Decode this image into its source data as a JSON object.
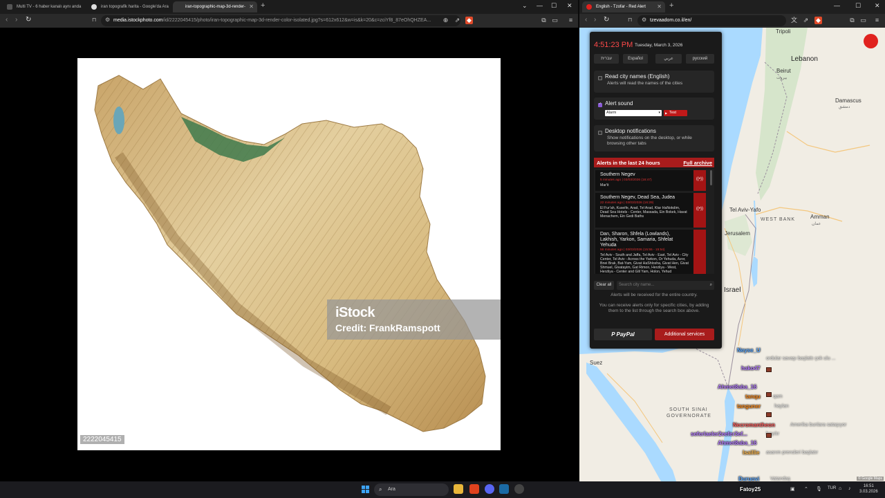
{
  "left_browser": {
    "tabs": [
      {
        "label": "Multi TV - 6 haber kanalı aynı anda"
      },
      {
        "label": "iran topografik harita - Google'da Ara"
      },
      {
        "label": "iran-topographic-map-3d-render-"
      }
    ],
    "url_host": "media.istockphoto.com",
    "url_path": "/id/2222045415/photo/iran-topographic-map-3d-render-color-isolated.jpg?s=612x612&w=is&k=20&c=zciYf8_87eOhQHZEA...",
    "image": {
      "watermark_logo": "iStock",
      "watermark_credit": "Credit: FrankRamspott",
      "image_id": "2222045415"
    }
  },
  "right_browser": {
    "tab_label": "English - Tzofar - Red Alert",
    "url": "tzevaadom.co.il/en/",
    "panel": {
      "time": "4:51:23 PM",
      "date": "Tuesday, March 3, 2026",
      "languages": [
        "עברית",
        "Español",
        "عربي",
        "русский"
      ],
      "read_names": {
        "title": "Read city names (English)",
        "desc": "Alerts will read the names of the cities"
      },
      "alert_sound": {
        "title": "Alert sound",
        "selected": "Alarm",
        "test_label": "Test"
      },
      "desktop": {
        "title": "Desktop notifications",
        "desc": "Show notifications on the desktop, or while browsing other tabs"
      },
      "alerts_title": "Alerts in the last 24 hours",
      "archive_label": "Full archive",
      "alerts": [
        {
          "area": "Southern Negev",
          "time": "5 minutes ago | 03/03/2026 (16:47)",
          "cities": "Mar'it"
        },
        {
          "area": "Southern Negev, Dead Sea, Judea",
          "time": "22 minutes ago | 03/03/2026 (16:29)",
          "cities": "El Fur'ah, Kuseife, Arad, Tel Arad, Ktar HaNokdim, Dead Sea Hotels - Center, Massada, Ein Bokek, Havat Menachem, Ein Gedi Baths"
        },
        {
          "area": "Dan, Sharon, Shfela (Lowlands), Lakhish, Yarkon, Samaria, Shfelat Yehuda",
          "time": "56 minutes ago | 03/03/2026 (15:55 - 15:54)",
          "cities": "Tel Aviv - South and Jaffa, Tel Aviv - East, Tel Aviv - City Center, Tel Aviv - Across the Yarkon, Or Yehuda, Azor, Bnei Brak, Bat-Yam, Givat HaShlosha, Givat Hen, Givat Shmuel, Givatayim, Gat Rimon, Herzliya - West, Herzliya - Center and Glil Yam, Holon, Yehud"
        }
      ],
      "clear_label": "Clear all",
      "search_placeholder": "Search city name...",
      "info1": "Alerts will be received for the entire country.",
      "info2": "You can receive alerts only for specific cities, by adding them to the list through the search box above.",
      "paypal_label": "PayPal",
      "services_label": "Additional services"
    },
    "map": {
      "labels": {
        "tripoli": "Tripoli",
        "lebanon": "Lebanon",
        "beirut": "Beirut",
        "beirut_ar": "بيروت",
        "damascus": "Damascus",
        "damascus_ar": "دمشق",
        "tel_aviv": "Tel Aviv-Yafo",
        "west_bank": "WEST BANK",
        "amman": "Amman",
        "amman_ar": "عمان",
        "jerusalem": "Jerusalem",
        "israel": "Israel",
        "suez": "Suez",
        "south_sinai": "SOUTH SINAI",
        "governorate": "GOVERNORATE"
      },
      "attribution": "© Google Maps"
    },
    "chat": [
      {
        "user": "Neyse_U",
        "msg": "ordular savaşı başlattı çok ulu ..."
      },
      {
        "user": "hako47",
        "msg": ""
      },
      {
        "user": "Ahmet8aba_16",
        "msg": ""
      },
      {
        "user": "tanqu",
        "msg": "qam"
      },
      {
        "user": "tanguner",
        "msg": "haylan"
      },
      {
        "user": "Necromantheon",
        "msg": "Amerika bunlara sataşıyor"
      },
      {
        "user": "seferlaeler2eefer3ef...",
        "msg": "bayılır"
      },
      {
        "user": "Ahmet8aba_16",
        "msg": ""
      },
      {
        "user": "lsaillie",
        "msg": "asarım prensleri başlatır"
      },
      {
        "user": "Duruovi",
        "msg": "Vatandaş"
      },
      {
        "user": "Fatoy25",
        "msg": ""
      }
    ]
  },
  "taskbar": {
    "search_label": "Ara",
    "lang": "TUR",
    "time": "16:51",
    "date": "3.03.2026"
  },
  "colors": {
    "alert_red": "#a81c1c",
    "clock_red": "#ff4a4a",
    "panel_bg": "#1a1a1a"
  }
}
